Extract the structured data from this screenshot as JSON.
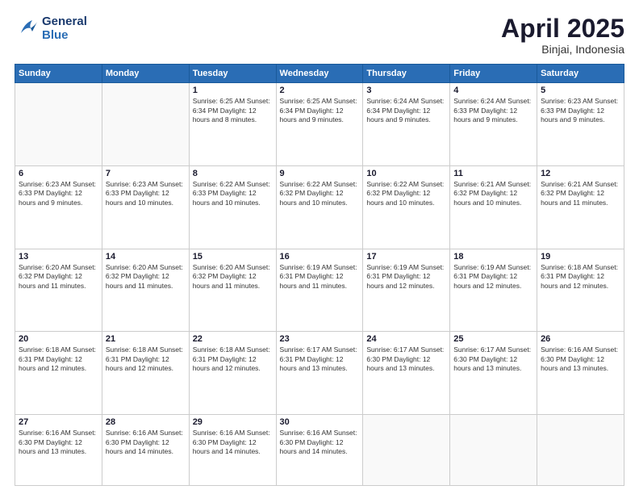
{
  "logo": {
    "line1": "General",
    "line2": "Blue"
  },
  "title": {
    "month": "April 2025",
    "location": "Binjai, Indonesia"
  },
  "days_of_week": [
    "Sunday",
    "Monday",
    "Tuesday",
    "Wednesday",
    "Thursday",
    "Friday",
    "Saturday"
  ],
  "weeks": [
    [
      {
        "day": "",
        "info": ""
      },
      {
        "day": "",
        "info": ""
      },
      {
        "day": "1",
        "info": "Sunrise: 6:25 AM\nSunset: 6:34 PM\nDaylight: 12 hours and 8 minutes."
      },
      {
        "day": "2",
        "info": "Sunrise: 6:25 AM\nSunset: 6:34 PM\nDaylight: 12 hours and 9 minutes."
      },
      {
        "day": "3",
        "info": "Sunrise: 6:24 AM\nSunset: 6:34 PM\nDaylight: 12 hours and 9 minutes."
      },
      {
        "day": "4",
        "info": "Sunrise: 6:24 AM\nSunset: 6:33 PM\nDaylight: 12 hours and 9 minutes."
      },
      {
        "day": "5",
        "info": "Sunrise: 6:23 AM\nSunset: 6:33 PM\nDaylight: 12 hours and 9 minutes."
      }
    ],
    [
      {
        "day": "6",
        "info": "Sunrise: 6:23 AM\nSunset: 6:33 PM\nDaylight: 12 hours and 9 minutes."
      },
      {
        "day": "7",
        "info": "Sunrise: 6:23 AM\nSunset: 6:33 PM\nDaylight: 12 hours and 10 minutes."
      },
      {
        "day": "8",
        "info": "Sunrise: 6:22 AM\nSunset: 6:33 PM\nDaylight: 12 hours and 10 minutes."
      },
      {
        "day": "9",
        "info": "Sunrise: 6:22 AM\nSunset: 6:32 PM\nDaylight: 12 hours and 10 minutes."
      },
      {
        "day": "10",
        "info": "Sunrise: 6:22 AM\nSunset: 6:32 PM\nDaylight: 12 hours and 10 minutes."
      },
      {
        "day": "11",
        "info": "Sunrise: 6:21 AM\nSunset: 6:32 PM\nDaylight: 12 hours and 10 minutes."
      },
      {
        "day": "12",
        "info": "Sunrise: 6:21 AM\nSunset: 6:32 PM\nDaylight: 12 hours and 11 minutes."
      }
    ],
    [
      {
        "day": "13",
        "info": "Sunrise: 6:20 AM\nSunset: 6:32 PM\nDaylight: 12 hours and 11 minutes."
      },
      {
        "day": "14",
        "info": "Sunrise: 6:20 AM\nSunset: 6:32 PM\nDaylight: 12 hours and 11 minutes."
      },
      {
        "day": "15",
        "info": "Sunrise: 6:20 AM\nSunset: 6:32 PM\nDaylight: 12 hours and 11 minutes."
      },
      {
        "day": "16",
        "info": "Sunrise: 6:19 AM\nSunset: 6:31 PM\nDaylight: 12 hours and 11 minutes."
      },
      {
        "day": "17",
        "info": "Sunrise: 6:19 AM\nSunset: 6:31 PM\nDaylight: 12 hours and 12 minutes."
      },
      {
        "day": "18",
        "info": "Sunrise: 6:19 AM\nSunset: 6:31 PM\nDaylight: 12 hours and 12 minutes."
      },
      {
        "day": "19",
        "info": "Sunrise: 6:18 AM\nSunset: 6:31 PM\nDaylight: 12 hours and 12 minutes."
      }
    ],
    [
      {
        "day": "20",
        "info": "Sunrise: 6:18 AM\nSunset: 6:31 PM\nDaylight: 12 hours and 12 minutes."
      },
      {
        "day": "21",
        "info": "Sunrise: 6:18 AM\nSunset: 6:31 PM\nDaylight: 12 hours and 12 minutes."
      },
      {
        "day": "22",
        "info": "Sunrise: 6:18 AM\nSunset: 6:31 PM\nDaylight: 12 hours and 12 minutes."
      },
      {
        "day": "23",
        "info": "Sunrise: 6:17 AM\nSunset: 6:31 PM\nDaylight: 12 hours and 13 minutes."
      },
      {
        "day": "24",
        "info": "Sunrise: 6:17 AM\nSunset: 6:30 PM\nDaylight: 12 hours and 13 minutes."
      },
      {
        "day": "25",
        "info": "Sunrise: 6:17 AM\nSunset: 6:30 PM\nDaylight: 12 hours and 13 minutes."
      },
      {
        "day": "26",
        "info": "Sunrise: 6:16 AM\nSunset: 6:30 PM\nDaylight: 12 hours and 13 minutes."
      }
    ],
    [
      {
        "day": "27",
        "info": "Sunrise: 6:16 AM\nSunset: 6:30 PM\nDaylight: 12 hours and 13 minutes."
      },
      {
        "day": "28",
        "info": "Sunrise: 6:16 AM\nSunset: 6:30 PM\nDaylight: 12 hours and 14 minutes."
      },
      {
        "day": "29",
        "info": "Sunrise: 6:16 AM\nSunset: 6:30 PM\nDaylight: 12 hours and 14 minutes."
      },
      {
        "day": "30",
        "info": "Sunrise: 6:16 AM\nSunset: 6:30 PM\nDaylight: 12 hours and 14 minutes."
      },
      {
        "day": "",
        "info": ""
      },
      {
        "day": "",
        "info": ""
      },
      {
        "day": "",
        "info": ""
      }
    ]
  ]
}
